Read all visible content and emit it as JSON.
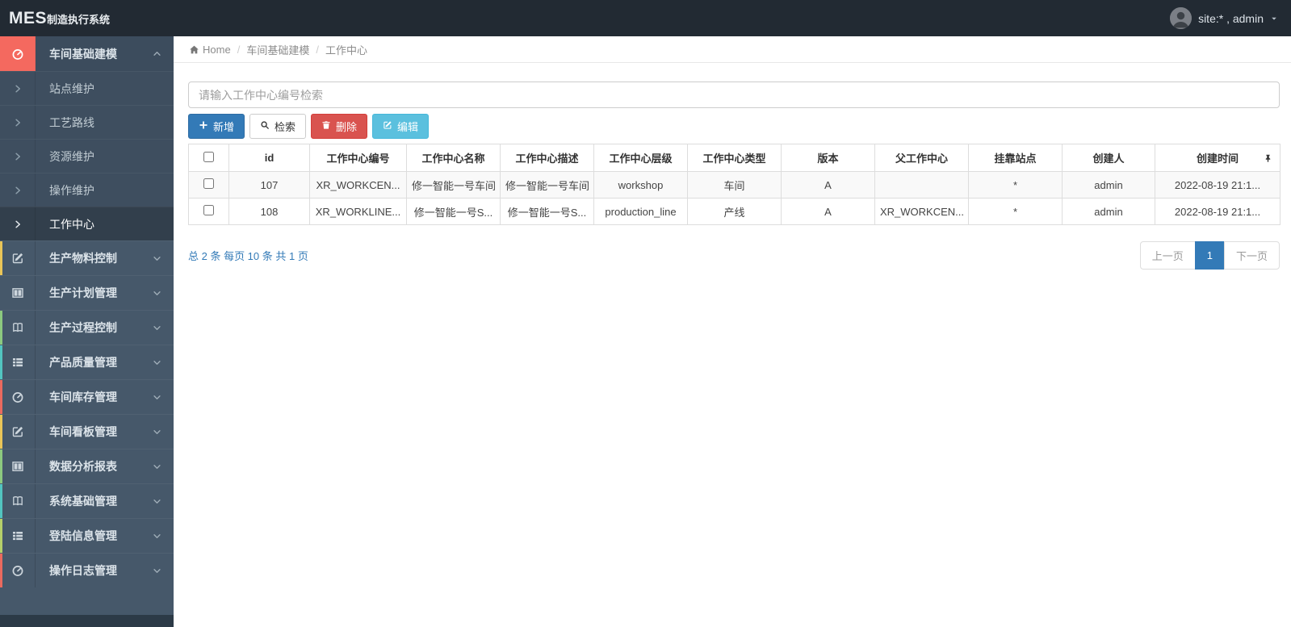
{
  "navbar": {
    "brand_bold": "MES",
    "brand_rest": "制造执行系统",
    "user_label": "site:* , admin"
  },
  "breadcrumb": {
    "items": [
      "Home",
      "车间基础建模",
      "工作中心"
    ]
  },
  "sidebar": {
    "items": [
      {
        "label": "车间基础建模",
        "icon": "tachometer-icon",
        "expanded": true,
        "active": true,
        "children": [
          {
            "label": "站点维护",
            "active": false
          },
          {
            "label": "工艺路线",
            "active": false
          },
          {
            "label": "资源维护",
            "active": false
          },
          {
            "label": "操作维护",
            "active": false
          },
          {
            "label": "工作中心",
            "active": true
          }
        ]
      },
      {
        "label": "生产物料控制",
        "icon": "edit-icon",
        "strip": "#e9c558"
      },
      {
        "label": "生产计划管理",
        "icon": "columns-icon",
        "strip": ""
      },
      {
        "label": "生产过程控制",
        "icon": "book-icon",
        "strip": "#8cc97f"
      },
      {
        "label": "产品质量管理",
        "icon": "list-icon",
        "strip": "#52c5c0"
      },
      {
        "label": "车间库存管理",
        "icon": "tachometer-icon",
        "strip": "#ea6a5f"
      },
      {
        "label": "车间看板管理",
        "icon": "edit-icon",
        "strip": "#e9c558"
      },
      {
        "label": "数据分析报表",
        "icon": "columns-icon",
        "strip": "#8cc97f"
      },
      {
        "label": "系统基础管理",
        "icon": "book-icon",
        "strip": "#52c5c0"
      },
      {
        "label": "登陆信息管理",
        "icon": "list-icon",
        "strip": "#b5d06a"
      },
      {
        "label": "操作日志管理",
        "icon": "tachometer-icon",
        "strip": "#ea6a5f"
      }
    ]
  },
  "toolbar": {
    "search_placeholder": "请输入工作中心编号检索",
    "buttons": [
      {
        "label": "新增",
        "icon": "plus-icon",
        "style": "primary"
      },
      {
        "label": "检索",
        "icon": "search-icon",
        "style": "default"
      },
      {
        "label": "删除",
        "icon": "trash-icon",
        "style": "danger"
      },
      {
        "label": "编辑",
        "icon": "edit-icon",
        "style": "info"
      }
    ]
  },
  "table": {
    "columns": [
      "id",
      "工作中心编号",
      "工作中心名称",
      "工作中心描述",
      "工作中心层级",
      "工作中心类型",
      "版本",
      "父工作中心",
      "挂靠站点",
      "创建人",
      "创建时间"
    ],
    "rows": [
      [
        "107",
        "XR_WORKCEN...",
        "修一智能一号车间",
        "修一智能一号车间",
        "workshop",
        "车间",
        "A",
        "",
        "*",
        "admin",
        "2022-08-19 21:1..."
      ],
      [
        "108",
        "XR_WORKLINE...",
        "修一智能一号S...",
        "修一智能一号S...",
        "production_line",
        "产线",
        "A",
        "XR_WORKCEN...",
        "*",
        "admin",
        "2022-08-19 21:1..."
      ]
    ]
  },
  "pagination": {
    "summary": "总 2 条 每页 10 条 共 1 页",
    "prev_label": "上一页",
    "current_page": "1",
    "next_label": "下一页"
  },
  "colors": {
    "navbar_bg": "#222a33",
    "sidebar_bg": "#46586a",
    "active_icon_bg": "#f4695f",
    "primary": "#337ab7",
    "danger": "#d9534f",
    "info": "#5bc0de",
    "pager_active": "#337ab7"
  }
}
